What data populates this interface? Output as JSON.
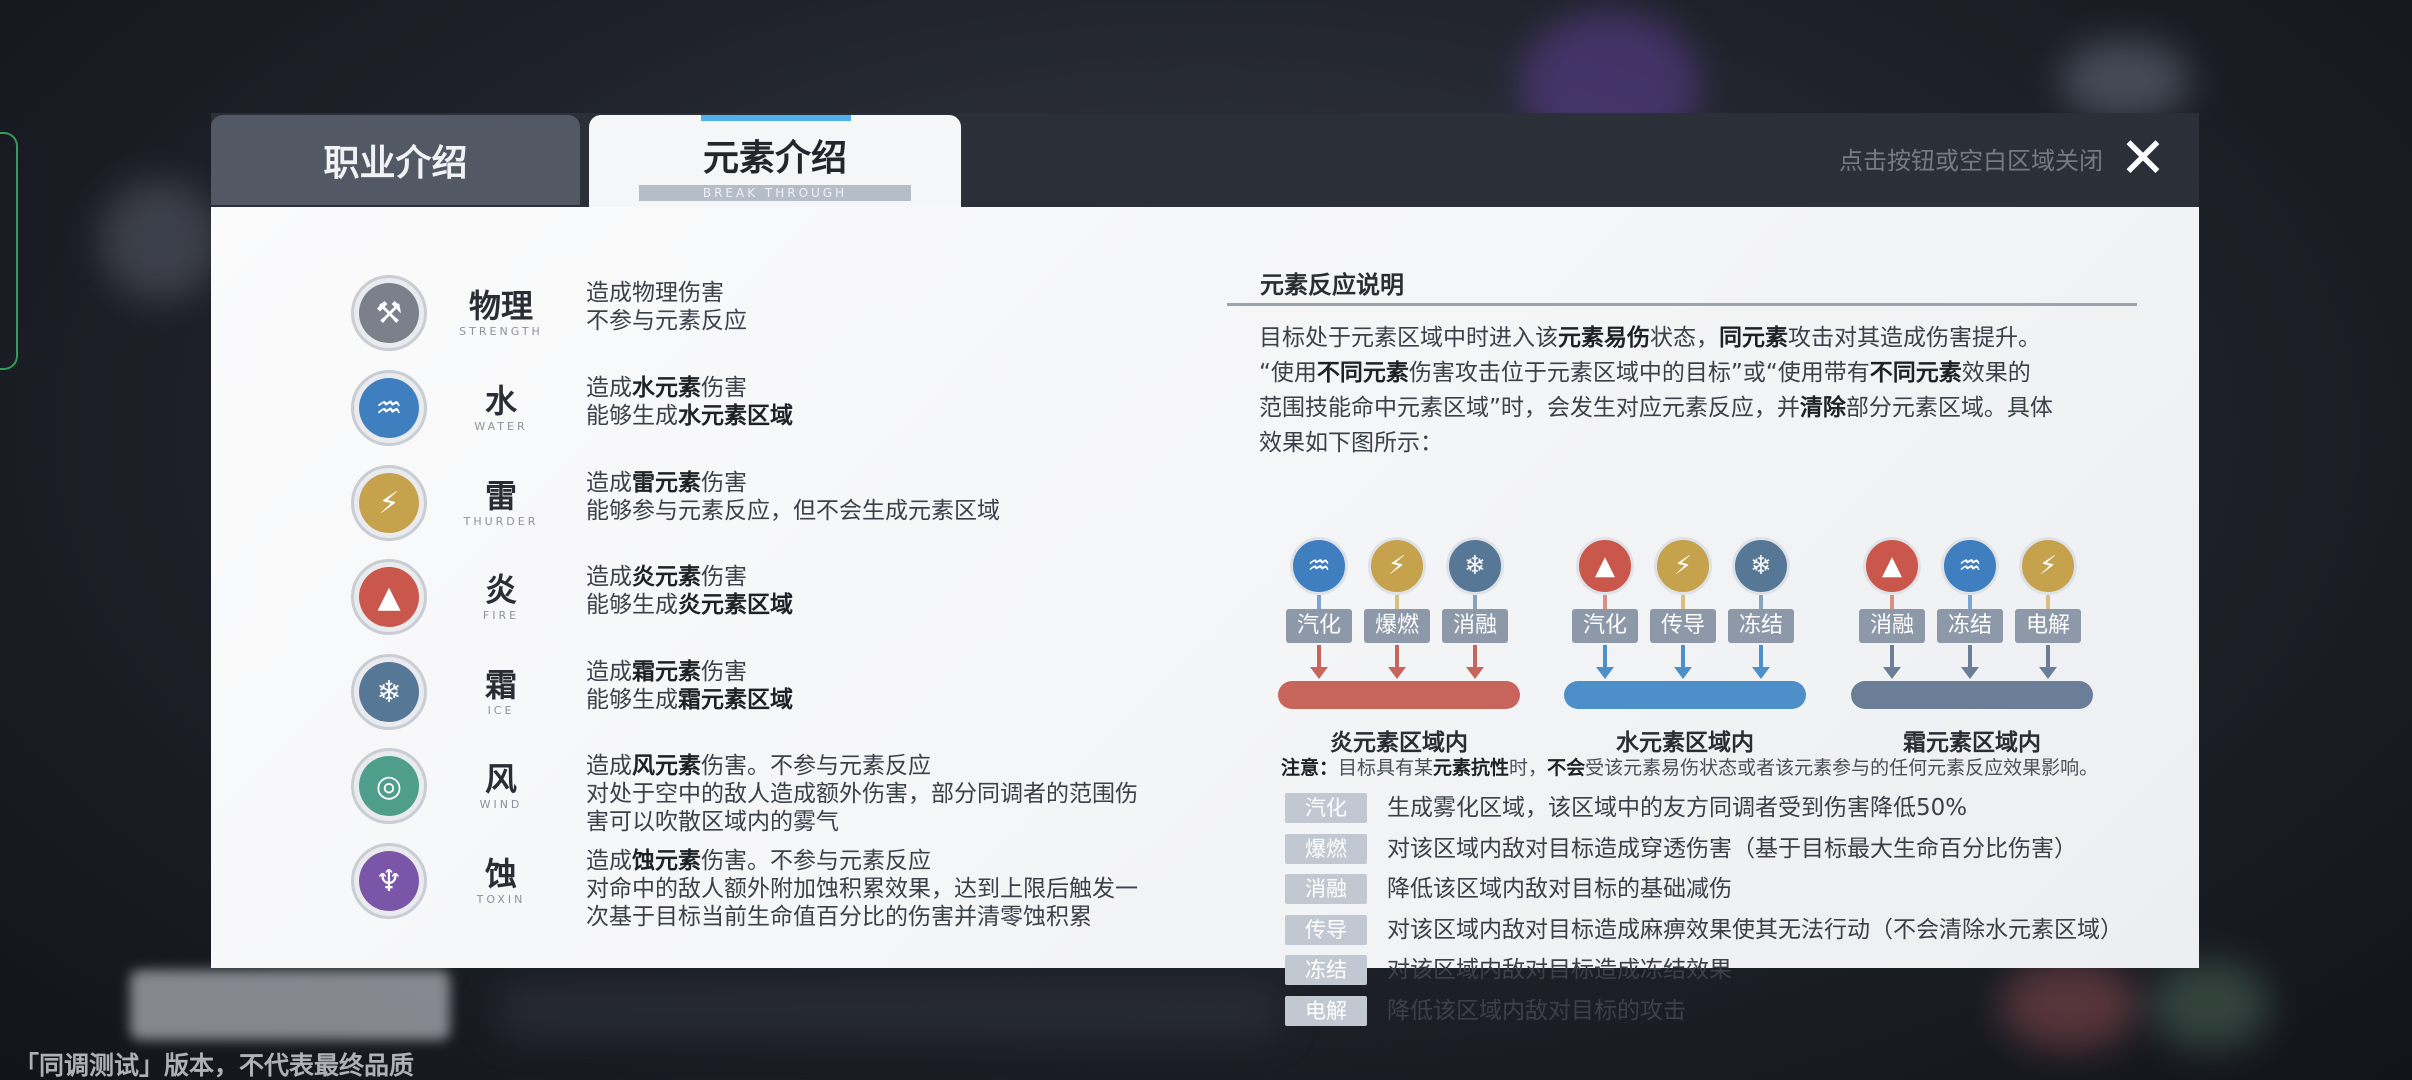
{
  "watermark": "「同调测试」版本，不代表最终品质",
  "tabs": {
    "job": "职业介绍",
    "element": "元素介绍",
    "element_sub": "BREAK THROUGH"
  },
  "close_hint": "点击按钮或空白区域关闭",
  "close_glyph": "✕",
  "elements": [
    {
      "name": "物理",
      "en": "STRENGTH",
      "glyph": "⚒",
      "color": "#7b808a",
      "line1": "造成物理伤害",
      "line2": "不参与元素反应"
    },
    {
      "name": "水",
      "en": "WATER",
      "glyph": "♒",
      "color": "#3f7fc0",
      "line1_pre": "造成",
      "line1_b": "水元素",
      "line1_post": "伤害",
      "line2_pre": "能够生成",
      "line2_b": "水元素区域"
    },
    {
      "name": "雷",
      "en": "THURDER",
      "glyph": "⚡",
      "color": "#c5a24b",
      "line1_pre": "造成",
      "line1_b": "雷元素",
      "line1_post": "伤害",
      "line2": "能够参与元素反应，但不会生成元素区域"
    },
    {
      "name": "炎",
      "en": "FIRE",
      "glyph": "▲",
      "color": "#c9574b",
      "line1_pre": "造成",
      "line1_b": "炎元素",
      "line1_post": "伤害",
      "line2_pre": "能够生成",
      "line2_b": "炎元素区域"
    },
    {
      "name": "霜",
      "en": "ICE",
      "glyph": "❄",
      "color": "#567796",
      "line1_pre": "造成",
      "line1_b": "霜元素",
      "line1_post": "伤害",
      "line2_pre": "能够生成",
      "line2_b": "霜元素区域"
    },
    {
      "name": "风",
      "en": "WIND",
      "glyph": "◎",
      "color": "#4f9e8c",
      "line1_pre": "造成",
      "line1_b": "风元素",
      "line1_post": "伤害。不参与元素反应",
      "line2": "对处于空中的敌人造成额外伤害，部分同调者的范围伤",
      "line3": "害可以吹散区域内的雾气"
    },
    {
      "name": "蚀",
      "en": "TOXIN",
      "glyph": "♆",
      "color": "#7a55a8",
      "line1_pre": "造成",
      "line1_b": "蚀元素",
      "line1_post": "伤害。不参与元素反应",
      "line2": "对命中的敌人额外附加蚀积累效果，达到上限后触发一",
      "line3": "次基于目标当前生命值百分比的伤害并清零蚀积累"
    }
  ],
  "reaction": {
    "title": "元素反应说明",
    "intro": {
      "p1_a": "目标处于元素区域中时进入该",
      "p1_b": "元素易伤",
      "p1_c": "状态，",
      "p1_d": "同元素",
      "p1_e": "攻击对其造成伤害提升。",
      "p2_a": "“使用",
      "p2_b": "不同元素",
      "p2_c": "伤害攻击位于元素区域中的目标”或“使用带有",
      "p2_d": "不同元素",
      "p2_e": "效果的",
      "p3_a": "范围技能命中元素区域”时，会发生对应元素反应，并",
      "p3_b": "清除",
      "p3_c": "部分元素区域。具体",
      "p4": "效果如下图所示："
    },
    "groups": [
      {
        "label": "炎元素区域内",
        "bar_color": "#c7655d",
        "items": [
          {
            "glyph": "♒",
            "color": "#3f7fc0",
            "stem": "#7aa6d6",
            "badge": "汽化",
            "arrow": "#c7655d"
          },
          {
            "glyph": "⚡",
            "color": "#c5a24b",
            "stem": "#d8be7f",
            "badge": "爆燃",
            "arrow": "#c7655d"
          },
          {
            "glyph": "❄",
            "color": "#567796",
            "stem": "#8aa3bb",
            "badge": "消融",
            "arrow": "#c7655d"
          }
        ]
      },
      {
        "label": "水元素区域内",
        "bar_color": "#4d8fc9",
        "items": [
          {
            "glyph": "▲",
            "color": "#c9574b",
            "stem": "#d98e86",
            "badge": "汽化",
            "arrow": "#4d8fc9"
          },
          {
            "glyph": "⚡",
            "color": "#c5a24b",
            "stem": "#d8be7f",
            "badge": "传导",
            "arrow": "#4d8fc9"
          },
          {
            "glyph": "❄",
            "color": "#567796",
            "stem": "#8aa3bb",
            "badge": "冻结",
            "arrow": "#4d8fc9"
          }
        ]
      },
      {
        "label": "霜元素区域内",
        "bar_color": "#6a7f97",
        "items": [
          {
            "glyph": "▲",
            "color": "#c9574b",
            "stem": "#d98e86",
            "badge": "消融",
            "arrow": "#6a7f97"
          },
          {
            "glyph": "♒",
            "color": "#3f7fc0",
            "stem": "#7aa6d6",
            "badge": "冻结",
            "arrow": "#6a7f97"
          },
          {
            "glyph": "⚡",
            "color": "#c5a24b",
            "stem": "#d8be7f",
            "badge": "电解",
            "arrow": "#6a7f97"
          }
        ]
      }
    ],
    "note": {
      "a": "注意：",
      "b": "目标具有某",
      "c": "元素抗性",
      "d": "时，",
      "e": "不会",
      "f": "受该元素易伤状态或者该元素参与的任何元素反应效果影响。"
    },
    "list": [
      {
        "tag": "汽化",
        "text": "生成雾化区域，该区域中的友方同调者受到伤害降低50%"
      },
      {
        "tag": "爆燃",
        "text": "对该区域内敌对目标造成穿透伤害（基于目标最大生命百分比伤害）"
      },
      {
        "tag": "消融",
        "text": "降低该区域内敌对目标的基础减伤"
      },
      {
        "tag": "传导",
        "text": "对该区域内敌对目标造成麻痹效果使其无法行动（不会清除水元素区域）"
      },
      {
        "tag": "冻结",
        "text": "对该区域内敌对目标造成冻结效果"
      },
      {
        "tag": "电解",
        "text": "降低该区域内敌对目标的攻击"
      }
    ]
  }
}
